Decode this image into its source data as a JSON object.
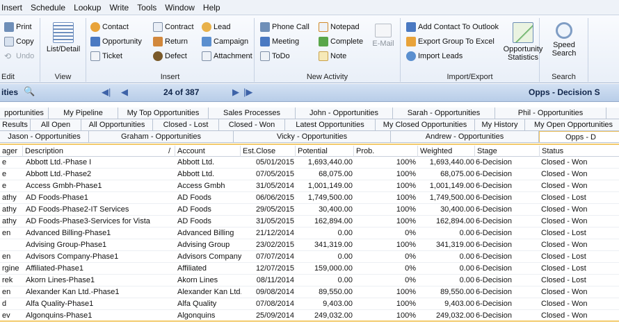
{
  "menu": [
    "Insert",
    "Schedule",
    "Lookup",
    "Write",
    "Tools",
    "Window",
    "Help"
  ],
  "ribbon": {
    "edit": {
      "label": "Edit",
      "print": "Print",
      "copy": "Copy",
      "undo": "Undo"
    },
    "view": {
      "label": "View",
      "list_detail": "List/Detail"
    },
    "insert": {
      "label": "Insert",
      "contact": "Contact",
      "contract": "Contract",
      "lead": "Lead",
      "opportunity": "Opportunity",
      "return": "Return",
      "campaign": "Campaign",
      "ticket": "Ticket",
      "defect": "Defect",
      "attachment": "Attachment"
    },
    "new_activity": {
      "label": "New Activity",
      "phone_call": "Phone Call",
      "notepad": "Notepad",
      "meeting": "Meeting",
      "complete": "Complete",
      "email": "E-Mail",
      "todo": "ToDo",
      "note": "Note"
    },
    "import_export": {
      "label": "Import/Export",
      "add_contact_outlook": "Add Contact To Outlook",
      "export_group_excel": "Export Group To Excel",
      "import_leads": "Import Leads",
      "opp_stats_line1": "Opportunity",
      "opp_stats_line2": "Statistics"
    },
    "search": {
      "label": "Search",
      "speed_search_line1": "Speed",
      "speed_search_line2": "Search"
    }
  },
  "titlebar": {
    "left_title": "ities",
    "record_counter": "24 of 387",
    "right_title": "Opps - Decision S"
  },
  "tabs_row1": [
    "pportunities",
    "My Pipeline",
    "My Top Opportunities",
    "Sales Processes",
    "John - Opportunities",
    "Sarah - Opportunities",
    "Phil - Opportunities"
  ],
  "tabs_row2": [
    "Results",
    "All Open",
    "All Opportunities",
    "Closed - Lost",
    "Closed - Won",
    "Latest Opportunities",
    "My Closed Opportunities",
    "My History",
    "My Open Opportunities"
  ],
  "tabs_row3": [
    "Jason - Opportunities",
    "Graham - Opportunities",
    "Vicky - Opportunities",
    "Andrew - Opportunities",
    "Opps - D"
  ],
  "columns": {
    "manager": "ager",
    "description": "Description",
    "sort_indicator": "/",
    "account": "Account",
    "est_close": "Est.Close",
    "potential": "Potential",
    "prob": "Prob.",
    "weighted": "Weighted",
    "stage": "Stage",
    "status": "Status"
  },
  "rows": [
    [
      "e",
      "Abbott Ltd.-Phase I",
      "Abbott Ltd.",
      "05/01/2015",
      "1,693,440.00",
      "100%",
      "1,693,440.00",
      "6-Decision",
      "Closed - Won"
    ],
    [
      "e",
      "Abbott Ltd.-Phase2",
      "Abbott Ltd.",
      "07/05/2015",
      "68,075.00",
      "100%",
      "68,075.00",
      "6-Decision",
      "Closed - Won"
    ],
    [
      "e",
      "Access Gmbh-Phase1",
      "Access Gmbh",
      "31/05/2014",
      "1,001,149.00",
      "100%",
      "1,001,149.00",
      "6-Decision",
      "Closed - Won"
    ],
    [
      "athy",
      "AD Foods-Phase1",
      "AD Foods",
      "06/06/2015",
      "1,749,500.00",
      "100%",
      "1,749,500.00",
      "6-Decision",
      "Closed - Lost"
    ],
    [
      "athy",
      "AD Foods-Phase2-IT Services",
      "AD Foods",
      "29/05/2015",
      "30,400.00",
      "100%",
      "30,400.00",
      "6-Decision",
      "Closed - Won"
    ],
    [
      "athy",
      "AD Foods-Phase3-Services for Vista",
      "AD Foods",
      "31/05/2015",
      "162,894.00",
      "100%",
      "162,894.00",
      "6-Decision",
      "Closed - Won"
    ],
    [
      "en",
      "Advanced Billing-Phase1",
      "Advanced Billing",
      "21/12/2014",
      "0.00",
      "0%",
      "0.00",
      "6-Decision",
      "Closed - Lost"
    ],
    [
      "",
      "Advising Group-Phase1",
      "Advising Group",
      "23/02/2015",
      "341,319.00",
      "100%",
      "341,319.00",
      "6-Decision",
      "Closed - Won"
    ],
    [
      "en",
      "Advisors Company-Phase1",
      "Advisors Company",
      "07/07/2014",
      "0.00",
      "0%",
      "0.00",
      "6-Decision",
      "Closed - Lost"
    ],
    [
      "rgine",
      "Affiliated-Phase1",
      "Affiliated",
      "12/07/2015",
      "159,000.00",
      "0%",
      "0.00",
      "6-Decision",
      "Closed - Lost"
    ],
    [
      "rek",
      "Akorn Lines-Phase1",
      "Akorn Lines",
      "08/11/2014",
      "0.00",
      "0%",
      "0.00",
      "6-Decision",
      "Closed - Lost"
    ],
    [
      "en",
      "Alexander Kan Ltd.-Phase1",
      "Alexander Kan Ltd.",
      "09/08/2014",
      "89,550.00",
      "100%",
      "89,550.00",
      "6-Decision",
      "Closed - Won"
    ],
    [
      "d",
      "Alfa Quality-Phase1",
      "Alfa Quality",
      "07/08/2014",
      "9,403.00",
      "100%",
      "9,403.00",
      "6-Decision",
      "Closed - Won"
    ],
    [
      "ev",
      "Algonquins-Phase1",
      "Algonquins",
      "25/09/2014",
      "249,032.00",
      "100%",
      "249,032.00",
      "6-Decision",
      "Closed - Won"
    ]
  ]
}
